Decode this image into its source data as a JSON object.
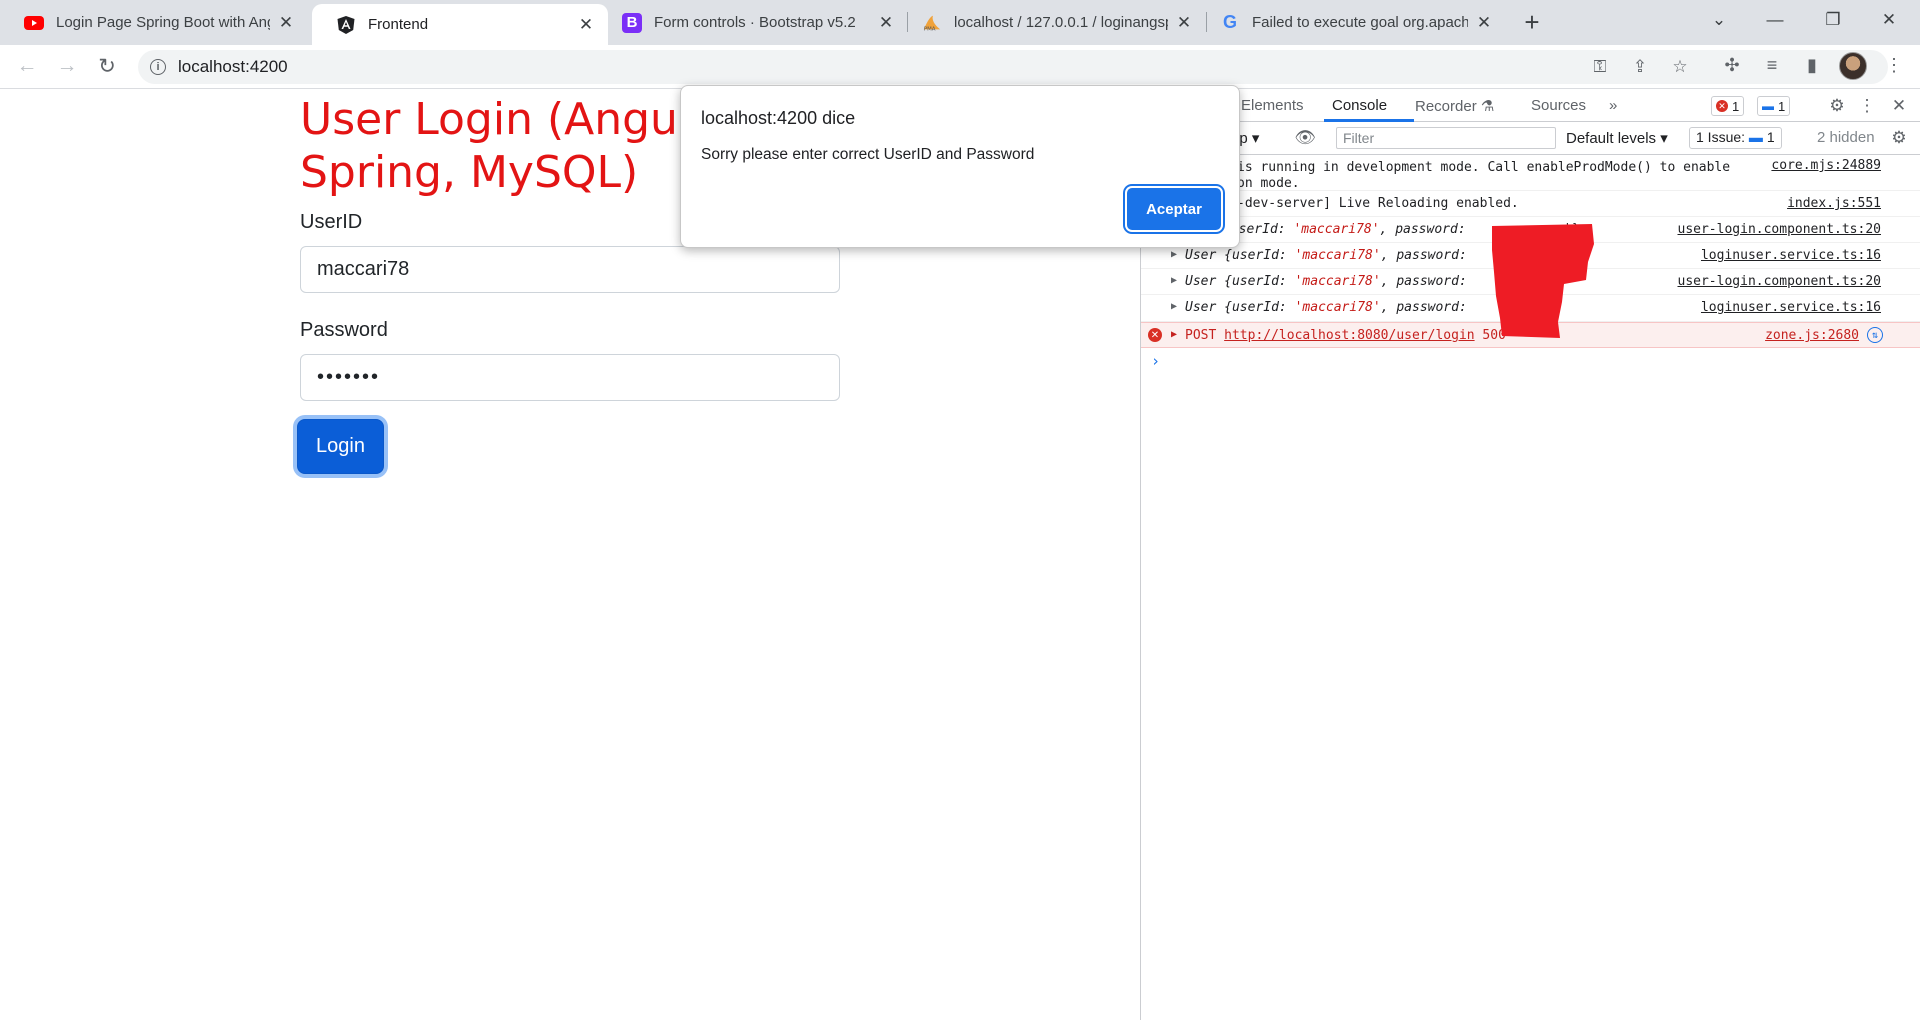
{
  "browser": {
    "tabs": [
      {
        "title": "Login Page Spring Boot with Angula",
        "icon": "youtube-icon",
        "active": false
      },
      {
        "title": "Frontend",
        "icon": "angular-icon",
        "active": true
      },
      {
        "title": "Form controls · Bootstrap v5.2",
        "icon": "bootstrap-icon",
        "active": false
      },
      {
        "title": "localhost / 127.0.0.1 / loginangsp",
        "icon": "phpmyadmin-icon",
        "active": false
      },
      {
        "title": "Failed to execute goal org.apache.m",
        "icon": "google-icon",
        "active": false
      }
    ],
    "url": "localhost:4200"
  },
  "page": {
    "title_line1": "User Login (Angular,",
    "title_line2": "Spring, MySQL)",
    "userid_label": "UserID",
    "userid_value": "maccari78",
    "password_label": "Password",
    "password_value": "•••••••",
    "login_button": "Login"
  },
  "dialog": {
    "title": "localhost:4200 dice",
    "message": "Sorry please enter correct UserID and Password",
    "ok_button": "Aceptar"
  },
  "devtools": {
    "tabs": [
      "Elements",
      "Console",
      "Recorder",
      "Sources"
    ],
    "active_tab": "Console",
    "error_count": "1",
    "message_count": "1",
    "context": "op",
    "filter_placeholder": "Filter",
    "levels": "Default levels",
    "issues_label": "1 Issue:",
    "issues_count": "1",
    "hidden_label": "2 hidden",
    "console": [
      {
        "text1": "is running in development mode. Call enableProdMode() to enable",
        "text2": "on mode.",
        "source": "core.mjs:24889"
      },
      {
        "text": "-dev-server] Live Reloading enabled.",
        "source": "index.js:551"
      },
      {
        "prefix": "",
        "user_id": "'maccari78'",
        "source": "user-login.component.ts:20"
      },
      {
        "prefix": "User ",
        "user_id": "'maccari78'",
        "source": "loginuser.service.ts:16"
      },
      {
        "prefix": "User ",
        "user_id": "'maccari78'",
        "source": "user-login.component.ts:20"
      },
      {
        "prefix": "User ",
        "user_id": "'maccari78'",
        "source": "loginuser.service.ts:16"
      },
      {
        "method": "POST",
        "url": "http://localhost:8080/user/login",
        "status": "500",
        "source": "zone.js:2680"
      }
    ]
  },
  "colors": {
    "title_red": "#e31414",
    "primary_blue": "#0b5ed7",
    "dialog_button": "#1a73e8"
  }
}
